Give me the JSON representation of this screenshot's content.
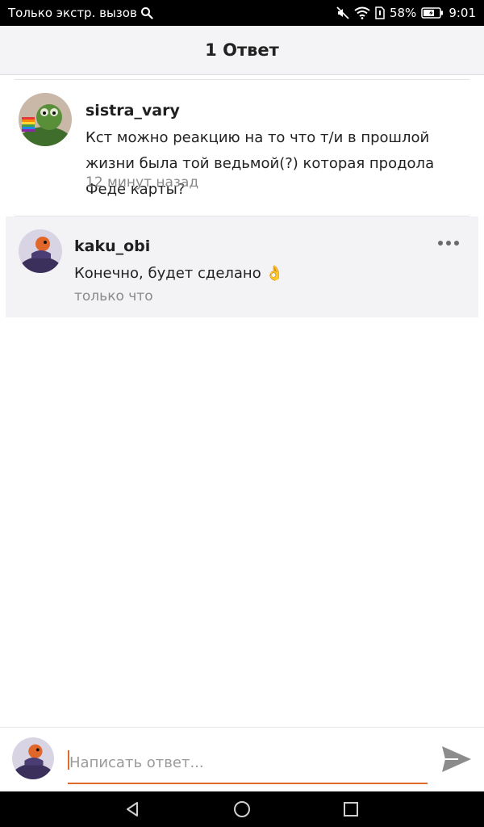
{
  "status_bar": {
    "carrier_text": "Только экстр. вызов",
    "battery": "58%",
    "time": "9:01",
    "icons": [
      "search-icon",
      "mute-icon",
      "wifi-icon",
      "sim-icon",
      "battery-icon"
    ]
  },
  "header": {
    "title": "1 Ответ"
  },
  "comment": {
    "username": "sistra_vary",
    "text": "Кст можно реакцию на то что т/и в прошлой жизни была той ведьмой(?) которая продола Феде карты?",
    "time": "12 минут назад"
  },
  "reply": {
    "username": "kaku_obi",
    "text": "Конечно, будет сделано 👌",
    "time": "только что"
  },
  "input": {
    "placeholder": "Написать ответ...",
    "value": ""
  },
  "colors": {
    "accent": "#e06a2c",
    "header_bg": "#f4f4f6",
    "reply_bg": "#f3f2f5"
  },
  "nav": {
    "icons": [
      "back-icon",
      "home-icon",
      "recents-icon"
    ]
  }
}
